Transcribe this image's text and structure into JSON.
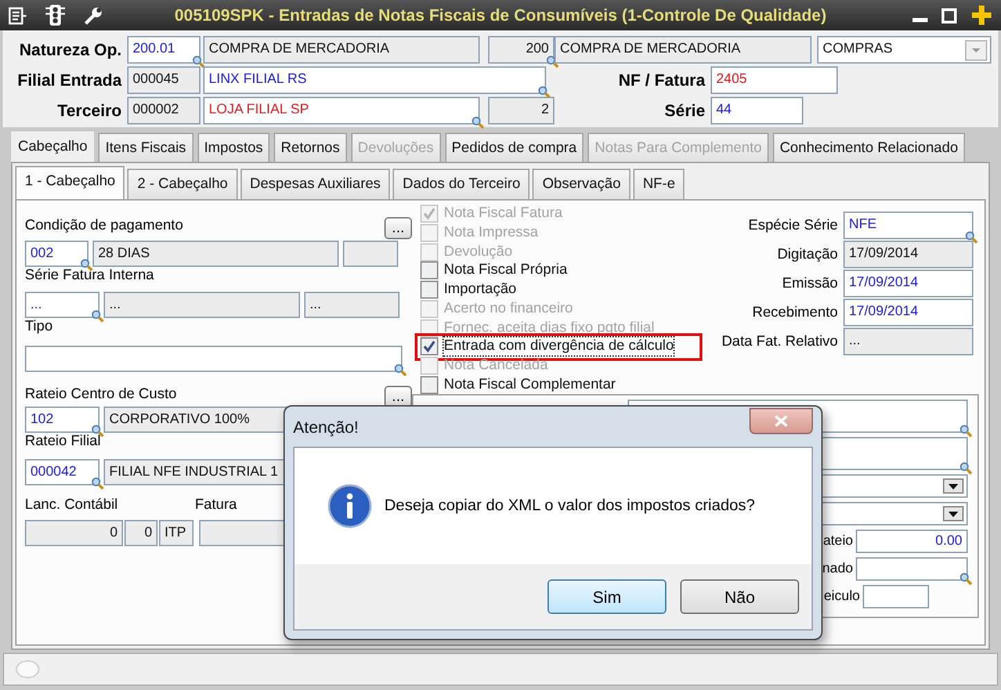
{
  "title_bar": {
    "title": "005109SPK - Entradas de Notas Fiscais de Consumíveis (1-Controle De Qualidade)"
  },
  "header": {
    "natureza_op": {
      "label": "Natureza Op.",
      "code": {
        "value": "200.01",
        "kind": "input",
        "lookup": true
      },
      "description": {
        "value": "COMPRA DE MERCADORIA",
        "kind": "readonly",
        "lookup": false
      },
      "number": {
        "value": "200",
        "kind": "readonly",
        "lookup": true
      },
      "description2": {
        "value": "COMPRA DE MERCADORIA",
        "kind": "readonly",
        "lookup": false
      },
      "dropdown": "COMPRAS"
    },
    "filial_entrada": {
      "label": "Filial Entrada",
      "code": {
        "value": "000045",
        "kind": "readonly",
        "lookup": false
      },
      "description": {
        "value": "LINX FILIAL RS",
        "kind": "input",
        "lookup": true
      }
    },
    "terceiro": {
      "label": "Terceiro",
      "code": {
        "value": "000002",
        "kind": "readonly",
        "lookup": false
      },
      "description": {
        "value": "LOJA FILIAL SP",
        "kind": "required",
        "lookup": true
      },
      "number": {
        "value": "2",
        "kind": "readonly",
        "lookup": false
      }
    },
    "nf_fatura": {
      "label": "NF / Fatura",
      "field": {
        "value": "2405",
        "kind": "required",
        "lookup": false
      }
    },
    "serie": {
      "label": "Série",
      "field": {
        "value": "44",
        "kind": "input",
        "lookup": false
      }
    }
  },
  "tabs": [
    {
      "label": "Cabeçalho",
      "selected": true,
      "disabled": false
    },
    {
      "label": "Itens Fiscais",
      "selected": false,
      "disabled": false
    },
    {
      "label": "Impostos",
      "selected": false,
      "disabled": false
    },
    {
      "label": "Retornos",
      "selected": false,
      "disabled": false
    },
    {
      "label": "Devoluções",
      "selected": false,
      "disabled": true
    },
    {
      "label": "Pedidos de compra",
      "selected": false,
      "disabled": false
    },
    {
      "label": "Notas Para Complemento",
      "selected": false,
      "disabled": true
    },
    {
      "label": "Conhecimento Relacionado",
      "selected": false,
      "disabled": false
    }
  ],
  "subtabs": [
    {
      "label": "1 - Cabeçalho",
      "selected": true
    },
    {
      "label": "2 - Cabeçalho",
      "selected": false
    },
    {
      "label": "Despesas Auxiliares",
      "selected": false
    },
    {
      "label": "Dados do Terceiro",
      "selected": false
    },
    {
      "label": "Observação",
      "selected": false
    },
    {
      "label": "NF-e",
      "selected": false
    }
  ],
  "left_groups": [
    {
      "label": "Condição de pagamento",
      "button": "...",
      "fields": [
        {
          "value": "002",
          "kind": "input",
          "lookup": true
        },
        {
          "value": "28 DIAS",
          "kind": "readonly",
          "lookup": false
        },
        {
          "kind": "readonly",
          "lookup": false
        }
      ]
    },
    {
      "label": "Série Fatura Interna",
      "fields": [
        {
          "value": "...",
          "kind": "input",
          "lookup": true
        },
        {
          "value": "...",
          "kind": "readonly",
          "lookup": false
        },
        {
          "value": "...",
          "kind": "readonly",
          "lookup": false
        }
      ]
    },
    {
      "label": "Tipo",
      "fields": [
        {
          "kind": "input",
          "lookup": true
        }
      ]
    },
    {
      "label": "Rateio Centro de Custo",
      "button": "...",
      "fields": [
        {
          "value": "102",
          "kind": "input",
          "lookup": true
        },
        {
          "value": "CORPORATIVO 100%",
          "kind": "readonly"
        }
      ]
    },
    {
      "label": "Rateio Filial",
      "fields": [
        {
          "value": "000042",
          "kind": "input",
          "lookup": true
        },
        {
          "value": "FILIAL NFE INDUSTRIAL 1",
          "kind": "readonly"
        }
      ]
    }
  ],
  "lanc_contabil": {
    "label": "Lanc. Contábil",
    "fields": [
      {
        "value": "0",
        "kind": "readonly",
        "lookup": false
      },
      {
        "value": "0",
        "kind": "readonly",
        "lookup": false
      },
      {
        "value": "ITP",
        "kind": "readonly",
        "lookup": false
      }
    ]
  },
  "fatura": {
    "label": "Fatura"
  },
  "checkboxes": [
    {
      "label": "Nota Fiscal Fatura",
      "checked": true,
      "disabled": true,
      "focused": false,
      "highlighted": false
    },
    {
      "label": "Nota Impressa",
      "checked": false,
      "disabled": true,
      "focused": false,
      "highlighted": false
    },
    {
      "label": "Devolução",
      "checked": false,
      "disabled": true,
      "focused": false,
      "highlighted": false
    },
    {
      "label": "Nota Fiscal Própria",
      "checked": false,
      "disabled": false,
      "focused": false,
      "highlighted": false
    },
    {
      "label": "Importação",
      "checked": false,
      "disabled": false,
      "focused": false,
      "highlighted": false
    },
    {
      "label": "Acerto no financeiro",
      "checked": false,
      "disabled": true,
      "focused": false,
      "highlighted": false
    },
    {
      "label": "Fornec. aceita dias fixo pgto filial",
      "checked": false,
      "disabled": true,
      "focused": false,
      "highlighted": false
    },
    {
      "label": "Entrada com divergência de cálculo",
      "checked": true,
      "disabled": false,
      "focused": true,
      "highlighted": true
    },
    {
      "label": "Nota Cancelada",
      "checked": false,
      "disabled": true,
      "focused": false,
      "highlighted": false
    },
    {
      "label": "Nota Fiscal Complementar",
      "checked": false,
      "disabled": false,
      "focused": false,
      "highlighted": false
    }
  ],
  "right_fields": [
    {
      "label": "Espécie Série",
      "value": "NFE",
      "kind": "input",
      "lookup": true
    },
    {
      "label": "Digitação",
      "value": "17/09/2014",
      "kind": "readonly",
      "lookup": false
    },
    {
      "label": "Emissão",
      "value": "17/09/2014",
      "kind": "input",
      "lookup": false
    },
    {
      "label": "Recebimento",
      "value": "17/09/2014",
      "kind": "input",
      "lookup": false
    },
    {
      "label": "Data Fat. Relativo",
      "value": "...",
      "kind": "readonly",
      "lookup": false
    }
  ],
  "lower_rows": [
    {
      "kind": "lookup"
    },
    {
      "kind": "lookup"
    },
    {
      "kind": "dropdown"
    },
    {
      "kind": "dropdown"
    },
    {
      "kind": "amount",
      "label": "ateio",
      "value": "0.00"
    },
    {
      "kind": "search",
      "label": "nado"
    },
    {
      "kind": "text",
      "label": "eiculo"
    }
  ],
  "dialog": {
    "title": "Atenção!",
    "message": "Deseja copiar do XML o valor dos impostos criados?",
    "buttons": [
      {
        "label": "Sim",
        "selected": true
      },
      {
        "label": "Não",
        "selected": false
      }
    ]
  }
}
